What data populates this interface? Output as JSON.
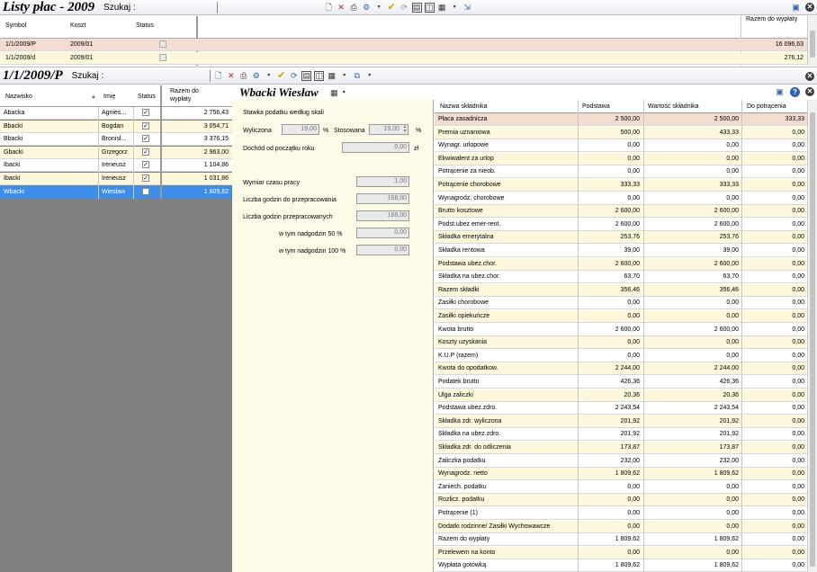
{
  "top": {
    "title": "Listy płac - 2009",
    "search_label": "Szukaj",
    "columns": {
      "symbol": "Symbol",
      "koszt": "Koszt",
      "status": "Status",
      "razem": "Razem do wypłaty"
    },
    "rows": [
      {
        "symbol": "1/1/2009/P",
        "koszt": "2009/01",
        "razem": "16 096,63"
      },
      {
        "symbol": "1/1/2009/d",
        "koszt": "2009/01",
        "razem": "276,12"
      }
    ]
  },
  "employees": {
    "title": "1/1/2009/P",
    "search_label": "Szukaj",
    "columns": {
      "nazwisko": "Nazwisko",
      "imie": "Imię",
      "status": "Status",
      "razem": "Razem do wypłaty"
    },
    "rows": [
      {
        "nazwisko": "Abacka",
        "imie": "Agnies...",
        "razem": "2 756,43"
      },
      {
        "nazwisko": "Bbacki",
        "imie": "Bogdan",
        "razem": "3 054,71"
      },
      {
        "nazwisko": "Bbacki",
        "imie": "Bronisł...",
        "razem": "3 376,15"
      },
      {
        "nazwisko": "Gbacki",
        "imie": "Grzegorz",
        "razem": "2 963,00"
      },
      {
        "nazwisko": "Ibacki",
        "imie": "Ireneusz",
        "razem": "1 104,86"
      },
      {
        "nazwisko": "Ibacki",
        "imie": "Ireneusz",
        "razem": "1 031,86"
      },
      {
        "nazwisko": "Wbacki",
        "imie": "Wiesław",
        "razem": "1 809,62"
      }
    ]
  },
  "detail": {
    "title": "Wbacki Wiesław",
    "form": {
      "stawka_label": "Stawka podatku według skali",
      "wyliczona_label": "Wyliczona",
      "wyliczona_value": "19,00",
      "percent_sign": "%",
      "stosowana_label": "Stosowana",
      "stosowana_value": "19,00",
      "dochod_label": "Dochód od początku roku",
      "dochod_value": "0,00",
      "zl": "zł",
      "wymiar_label": "Wymiar czasu pracy",
      "wymiar_value": "1,00",
      "godz_do_label": "Liczba godzin do przepracowania",
      "godz_do_value": "168,00",
      "godz_prz_label": "Liczba godzin przepracowanych",
      "godz_prz_value": "168,00",
      "nadg50_label": "w tym nadgodzin 50 %",
      "nadg50_value": "0,00",
      "nadg100_label": "w tym nadgodzin 100 %",
      "nadg100_value": "0,00"
    },
    "components": {
      "columns": {
        "nazwa": "Nazwa składnika",
        "podstawa": "Podstawa",
        "wartosc": "Wartość składnika",
        "do_potr": "Do potrącenia"
      },
      "rows": [
        [
          "Płaca zasadnicza",
          "2 500,00",
          "2 500,00",
          "333,33"
        ],
        [
          "Premia uznaniowa",
          "500,00",
          "433,33",
          "0,00"
        ],
        [
          "Wynagr. urlopowe",
          "0,00",
          "0,00",
          "0,00"
        ],
        [
          "Ekwiwalent za urlop",
          "0,00",
          "0,00",
          "0,00"
        ],
        [
          "Potrącenie za nieob.",
          "0,00",
          "0,00",
          "0,00"
        ],
        [
          "Potrącenie chorobowe",
          "333,33",
          "333,33",
          "0,00"
        ],
        [
          "Wynagrodz. chorobowe",
          "0,00",
          "0,00",
          "0,00"
        ],
        [
          "Brutto kosztowe",
          "2 600,00",
          "2 600,00",
          "0,00"
        ],
        [
          "Podst.ubez emer-rent.",
          "2 600,00",
          "2 600,00",
          "0,00"
        ],
        [
          "Składka emerytalna",
          "253,76",
          "253,76",
          "0,00"
        ],
        [
          "Składka rentowa",
          "39,00",
          "39,00",
          "0,00"
        ],
        [
          "Podstawa ubez.chor.",
          "2 600,00",
          "2 600,00",
          "0,00"
        ],
        [
          "Składka na ubez.chor.",
          "63,70",
          "63,70",
          "0,00"
        ],
        [
          "Razem składki",
          "356,46",
          "356,46",
          "0,00"
        ],
        [
          "Zasiłki chorobowe",
          "0,00",
          "0,00",
          "0,00"
        ],
        [
          "Zasiłki opiekuńcze",
          "0,00",
          "0,00",
          "0,00"
        ],
        [
          "Kwota brutto",
          "2 600,00",
          "2 600,00",
          "0,00"
        ],
        [
          "Koszty uzyskania",
          "0,00",
          "0,00",
          "0,00"
        ],
        [
          "K.U.P (razem)",
          "0,00",
          "0,00",
          "0,00"
        ],
        [
          "Kwota do opodatkow.",
          "2 244,00",
          "2 244,00",
          "0,00"
        ],
        [
          "Podatek brutto",
          "426,36",
          "426,36",
          "0,00"
        ],
        [
          "Ulga zaliczki",
          "20,36",
          "20,36",
          "0,00"
        ],
        [
          "Podstawa ubez.zdro.",
          "2 243,54",
          "2 243,54",
          "0,00"
        ],
        [
          "Składka zdr. wyliczona",
          "201,92",
          "201,92",
          "0,00"
        ],
        [
          "Składka na ubez.zdro.",
          "201,92",
          "201,92",
          "0,00"
        ],
        [
          "Składka zdr. do odliczenia",
          "173,87",
          "173,87",
          "0,00"
        ],
        [
          "Zaliczka podatku",
          "232,00",
          "232,00",
          "0,00"
        ],
        [
          "Wynagrodz. netto",
          "1 809,62",
          "1 809,62",
          "0,00"
        ],
        [
          "Zaniech. podatku",
          "0,00",
          "0,00",
          "0,00"
        ],
        [
          "Rozlicz. podatku",
          "0,00",
          "0,00",
          "0,00"
        ],
        [
          "Potrącenie (1)",
          "0,00",
          "0,00",
          "0,00"
        ],
        [
          "Dodatki rodzinne/ Zasiłki Wychowawcze",
          "0,00",
          "0,00",
          "0,00"
        ],
        [
          "Razem do wypłaty",
          "1 809,62",
          "1 809,62",
          "0,00"
        ],
        [
          "Przelewem na konto",
          "0,00",
          "0,00",
          "0,00"
        ],
        [
          "Wypłata gotówką",
          "1 809,62",
          "1 809,62",
          "0,00"
        ]
      ]
    }
  },
  "colors": {
    "highlight_row": "#f3dcd0",
    "alt_row": "#fdf7dc",
    "selected_row": "#3c8ee8",
    "panel_gray": "#808080"
  }
}
